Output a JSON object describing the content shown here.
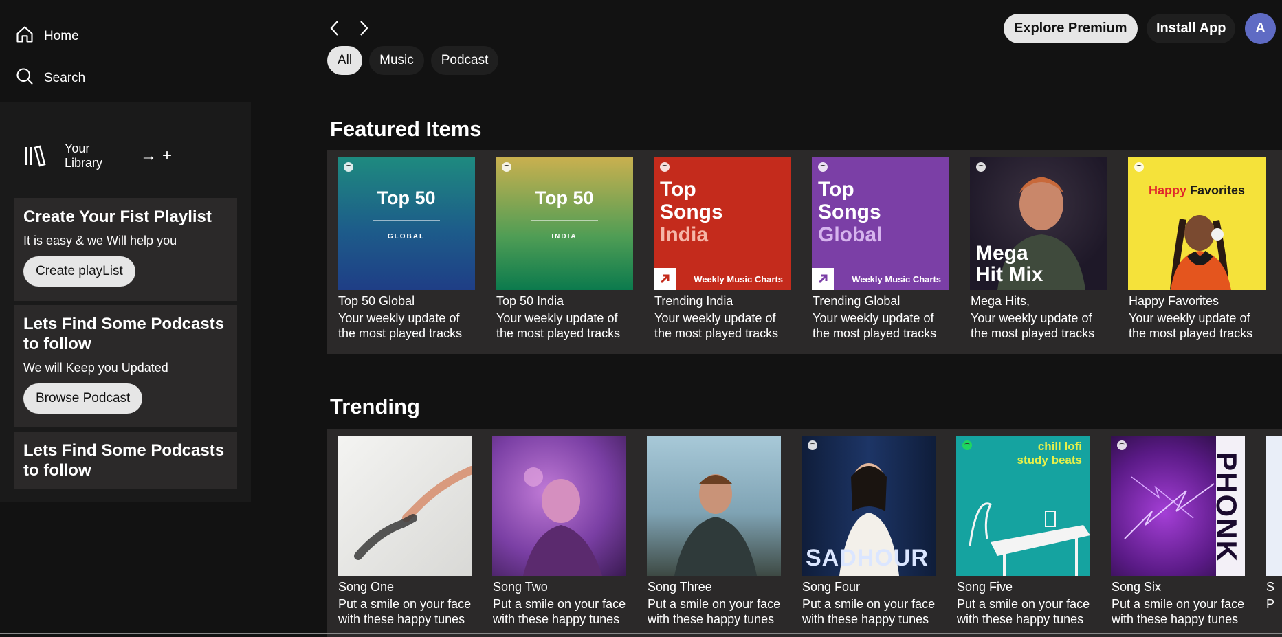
{
  "nav": {
    "home": "Home",
    "search": "Search"
  },
  "library": {
    "label": "Your Library",
    "arrow": "→",
    "plus": "+"
  },
  "cards": [
    {
      "title": "Create Your Fist Playlist",
      "subtitle": "It is easy & we Will help you",
      "button": "Create playList"
    },
    {
      "title": "Lets Find Some Podcasts to follow",
      "subtitle": "We will Keep you Updated",
      "button": "Browse Podcast"
    },
    {
      "title": "Lets Find Some Podcasts to follow"
    }
  ],
  "header": {
    "explore": "Explore Premium",
    "install": "Install App",
    "avatar": "A"
  },
  "chips": [
    "All",
    "Music",
    "Podcast"
  ],
  "featured": {
    "title": "Featured Items",
    "items": [
      {
        "title": "Top 50 Global",
        "desc": "Your weekly update of the most played tracks",
        "art_big": "Top 50",
        "art_small": "GLOBAL"
      },
      {
        "title": "Top 50 India",
        "desc": "Your weekly update of the most played tracks",
        "art_big": "Top 50",
        "art_small": "INDIA"
      },
      {
        "title": "Trending India",
        "desc": "Your weekly update of the most played tracks",
        "art_l1": "Top",
        "art_l2": "Songs",
        "art_l3": "India",
        "art_footer": "Weekly Music Charts"
      },
      {
        "title": "Trending Global",
        "desc": "Your weekly update of the most played tracks",
        "art_l1": "Top",
        "art_l2": "Songs",
        "art_l3": "Global",
        "art_footer": "Weekly Music Charts"
      },
      {
        "title": "Mega Hits,",
        "desc": "Your weekly update of the most played tracks",
        "art_l1": "Mega",
        "art_l2": "Hit Mix"
      },
      {
        "title": "Happy Favorites",
        "desc": "Your weekly update of the most played tracks",
        "art_a": "Happy",
        "art_b": "Favorites"
      }
    ]
  },
  "trending": {
    "title": "Trending",
    "items": [
      {
        "title": "Song One",
        "desc": "Put a smile on your face with these happy tunes"
      },
      {
        "title": "Song Two",
        "desc": "Put a smile on your face with these happy tunes"
      },
      {
        "title": "Song Three",
        "desc": "Put a smile on your face with these happy tunes"
      },
      {
        "title": "Song Four",
        "desc": "Put a smile on your face with these happy tunes",
        "art_text": "SADHOUR"
      },
      {
        "title": "Song Five",
        "desc": "Put a smile on your face with these happy tunes",
        "art_l1": "chill lofi",
        "art_l2": "study beats"
      },
      {
        "title": "Song Six",
        "desc": "Put a smile on your face with these happy tunes",
        "art_text": "PHONK"
      },
      {
        "title": "S",
        "desc": "P"
      }
    ]
  },
  "colors": {
    "bg": "#121212",
    "panel": "#2b2929",
    "accent_avatar": "#5f6bc4"
  }
}
